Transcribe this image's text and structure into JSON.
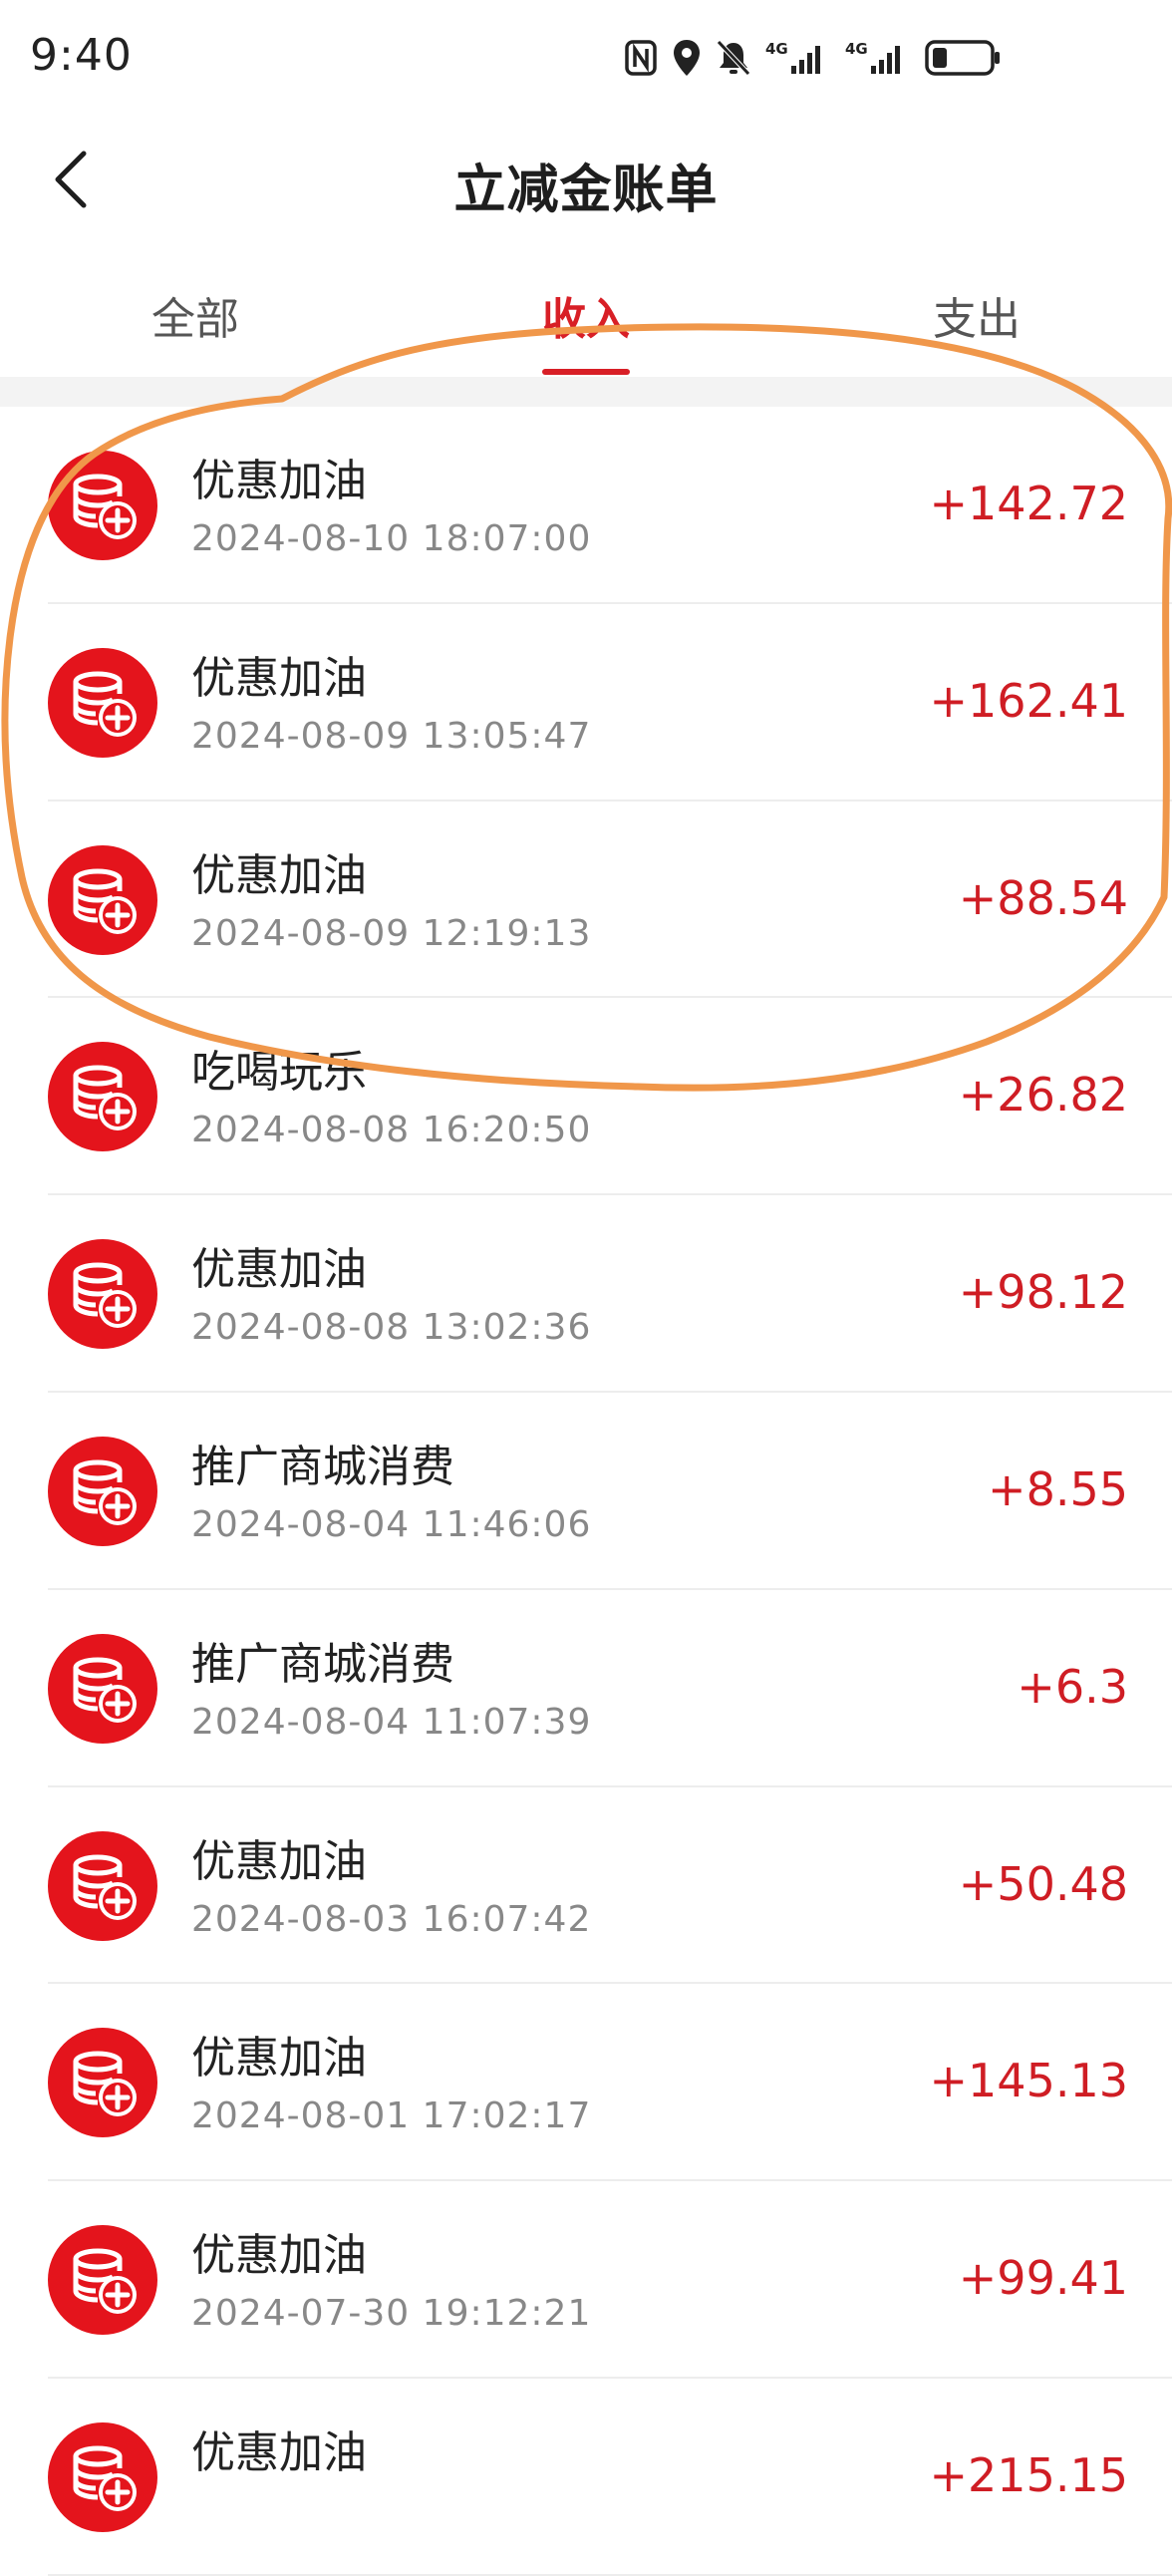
{
  "status_bar": {
    "time": "9:40",
    "icons": [
      "nfc-icon",
      "location-icon",
      "mute-bell-icon",
      "signal-4g-icon",
      "signal-4g-icon",
      "battery-icon"
    ],
    "network_label_1": "4G",
    "network_label_2": "4G"
  },
  "header": {
    "title": "立减金账单",
    "back_icon": "chevron-left-icon"
  },
  "tabs": [
    {
      "label": "全部",
      "active": false
    },
    {
      "label": "收入",
      "active": true
    },
    {
      "label": "支出",
      "active": false
    }
  ],
  "colors": {
    "accent": "#d81f26",
    "amount": "#cf1d24",
    "annotation": "#f0974a"
  },
  "transactions": [
    {
      "title": "优惠加油",
      "time": "2024-08-10 18:07:00",
      "amount": "+142.72"
    },
    {
      "title": "优惠加油",
      "time": "2024-08-09 13:05:47",
      "amount": "+162.41"
    },
    {
      "title": "优惠加油",
      "time": "2024-08-09 12:19:13",
      "amount": "+88.54"
    },
    {
      "title": "吃喝玩乐",
      "time": "2024-08-08 16:20:50",
      "amount": "+26.82"
    },
    {
      "title": "优惠加油",
      "time": "2024-08-08 13:02:36",
      "amount": "+98.12"
    },
    {
      "title": "推广商城消费",
      "time": "2024-08-04 11:46:06",
      "amount": "+8.55"
    },
    {
      "title": "推广商城消费",
      "time": "2024-08-04 11:07:39",
      "amount": "+6.3"
    },
    {
      "title": "优惠加油",
      "time": "2024-08-03 16:07:42",
      "amount": "+50.48"
    },
    {
      "title": "优惠加油",
      "time": "2024-08-01 17:02:17",
      "amount": "+145.13"
    },
    {
      "title": "优惠加油",
      "time": "2024-07-30 19:12:21",
      "amount": "+99.41"
    },
    {
      "title": "优惠加油",
      "time": "",
      "amount": "+215.15"
    }
  ]
}
